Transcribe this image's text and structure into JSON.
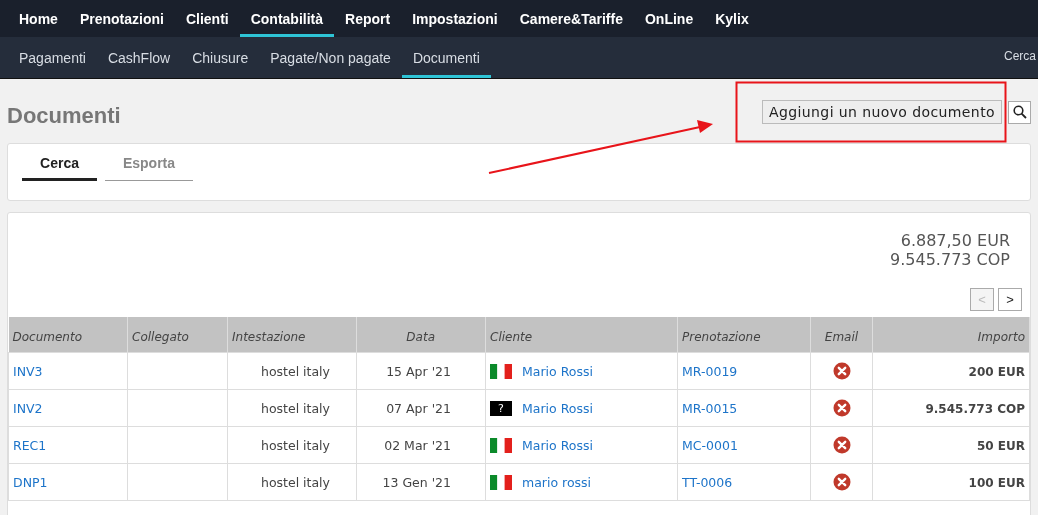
{
  "main_nav": [
    {
      "label": "Home",
      "selected": false
    },
    {
      "label": "Prenotazioni",
      "selected": false
    },
    {
      "label": "Clienti",
      "selected": false
    },
    {
      "label": "Contabilità",
      "selected": true
    },
    {
      "label": "Report",
      "selected": false
    },
    {
      "label": "Impostazioni",
      "selected": false
    },
    {
      "label": "Camere&Tariffe",
      "selected": false
    },
    {
      "label": "OnLine",
      "selected": false
    },
    {
      "label": "Kylix",
      "selected": false
    }
  ],
  "sub_nav": [
    {
      "label": "Pagamenti",
      "selected": false
    },
    {
      "label": "CashFlow",
      "selected": false
    },
    {
      "label": "Chiusure",
      "selected": false
    },
    {
      "label": "Pagate/Non pagate",
      "selected": false
    },
    {
      "label": "Documenti",
      "selected": true
    }
  ],
  "sub_nav_search": "Cerca",
  "page_title": "Documenti",
  "add_button": "Aggiungi un nuovo documento",
  "tabs": [
    {
      "label": "Cerca",
      "selected": true
    },
    {
      "label": "Esporta",
      "selected": false
    }
  ],
  "totals": [
    "6.887,50 EUR",
    "9.545.773 COP"
  ],
  "pager": {
    "prev": "<",
    "next": ">",
    "prev_disabled": true
  },
  "table": {
    "columns": [
      "Documento",
      "Collegato",
      "Intestazione",
      "Data",
      "Cliente",
      "Prenotazione",
      "Email",
      "Importo"
    ],
    "rows": [
      {
        "documento": "INV3",
        "intestazione": "hostel italy",
        "data": "15 Apr '21",
        "flag": {
          "kind": "italy"
        },
        "cliente": "Mario Rossi",
        "prenotazione": "MR-0019",
        "email_sent": false,
        "importo": "200 EUR"
      },
      {
        "documento": "INV2",
        "intestazione": "hostel italy",
        "data": "07 Apr '21",
        "flag": {
          "kind": "unknown",
          "text": "?"
        },
        "cliente": "Mario Rossi",
        "prenotazione": "MR-0015",
        "email_sent": false,
        "importo": "9.545.773 COP"
      },
      {
        "documento": "REC1",
        "intestazione": "hostel italy",
        "data": "02 Mar '21",
        "flag": {
          "kind": "italy"
        },
        "cliente": "Mario Rossi",
        "prenotazione": "MC-0001",
        "email_sent": false,
        "importo": "50 EUR"
      },
      {
        "documento": "DNP1",
        "intestazione": "hostel italy",
        "data": "13 Gen '21",
        "flag": {
          "kind": "italy"
        },
        "cliente": "mario rossi",
        "prenotazione": "TT-0006",
        "email_sent": false,
        "importo": "100 EUR"
      }
    ]
  }
}
